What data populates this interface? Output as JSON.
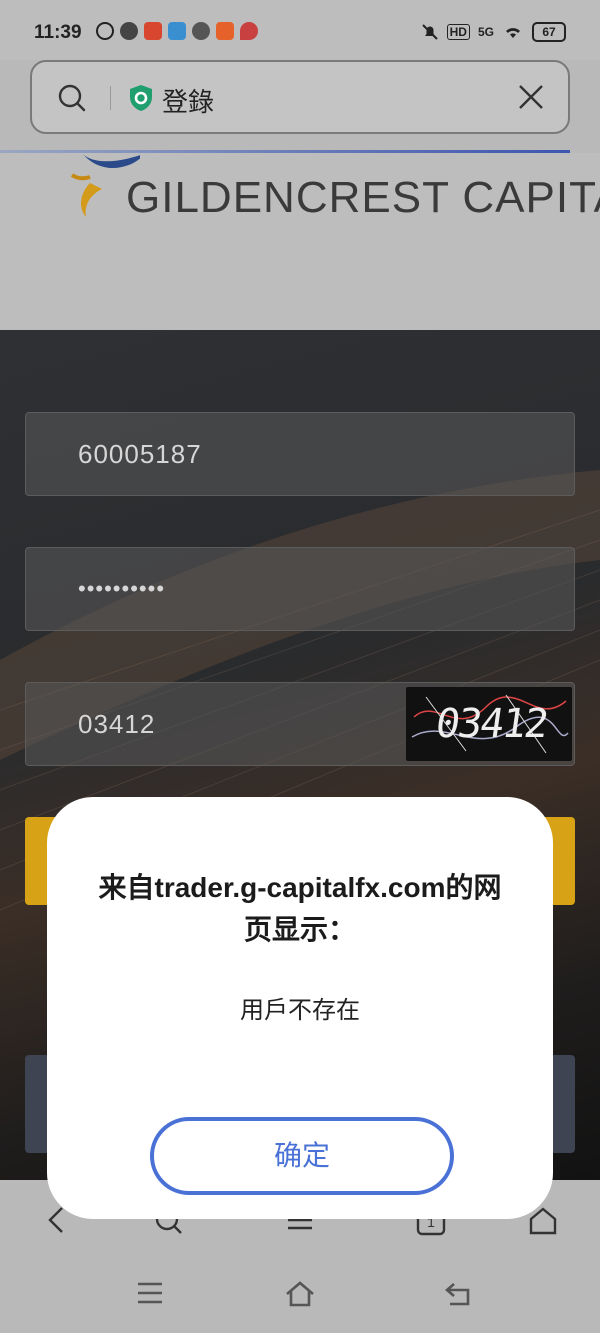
{
  "status_bar": {
    "time": "11:39",
    "signal": "5G",
    "hd": "HD",
    "battery": "67"
  },
  "address_bar": {
    "title": "登錄",
    "icons": [
      "search-icon",
      "shield-icon",
      "close-icon"
    ]
  },
  "logo": {
    "text": "GILDENCREST CAPITAL"
  },
  "login_form": {
    "account_value": "60005187",
    "password_value": "••••••••••",
    "captcha_value": "03412",
    "captcha_image_text": "03412"
  },
  "dialog": {
    "title": "来自trader.g-capitalfx.com的网页显示：",
    "message": "用戶不存在",
    "ok_label": "确定"
  },
  "bottom_nav": {
    "icons": [
      "back-icon",
      "search-icon",
      "menu-icon",
      "tabs-icon",
      "home-icon"
    ]
  },
  "system_nav": {
    "icons": [
      "recents-icon",
      "home-icon",
      "back-icon"
    ]
  },
  "colors": {
    "accent_blue": "#4a72d6",
    "submit_gold": "#d7a216",
    "shield_green": "#1f9e6e"
  }
}
